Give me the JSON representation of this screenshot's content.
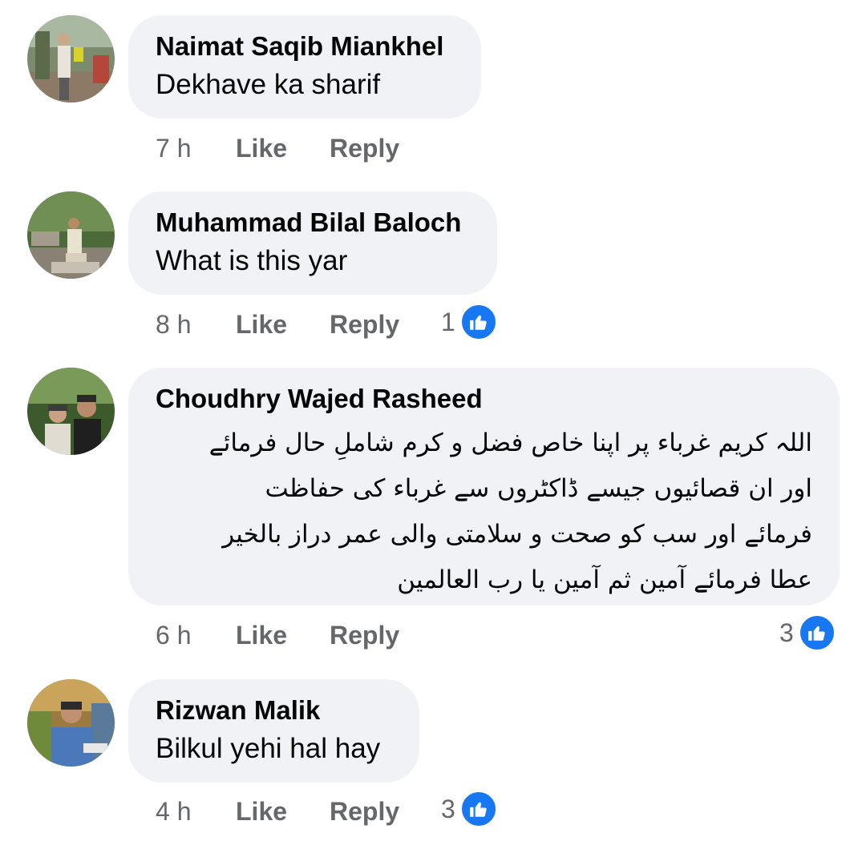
{
  "comments": [
    {
      "author": "Naimat Saqib Miankhel",
      "text": "Dekhave ka sharif",
      "time": "7 h",
      "like_label": "Like",
      "reply_label": "Reply",
      "reaction_count": null
    },
    {
      "author": "Muhammad Bilal Baloch",
      "text": "What is this yar",
      "time": "8 h",
      "like_label": "Like",
      "reply_label": "Reply",
      "reaction_count": "1"
    },
    {
      "author": "Choudhry Wajed Rasheed",
      "text_lines": [
        "اللہ کریم غرباء پر اپنا خاص فضل و کرم شاملِ حال فرمائے",
        "اور ان قصائیوں  جیسے ڈاکٹروں سے غرباء کی حفاظت",
        "فرمائے اور سب کو صحت و سلامتی والی عمر دراز بالخیر",
        "عطا فرمائے آمین ثم آمین یا رب العالمین"
      ],
      "time": "6 h",
      "like_label": "Like",
      "reply_label": "Reply",
      "reaction_count": "3"
    },
    {
      "author": "Rizwan Malik",
      "text": "Bilkul yehi hal hay",
      "time": "4 h",
      "like_label": "Like",
      "reply_label": "Reply",
      "reaction_count": "3"
    }
  ],
  "reaction_icon": "thumbs-up-icon",
  "colors": {
    "bubble_bg": "#f0f2f5",
    "meta_text": "#65676b",
    "like_blue": "#1877f2"
  }
}
